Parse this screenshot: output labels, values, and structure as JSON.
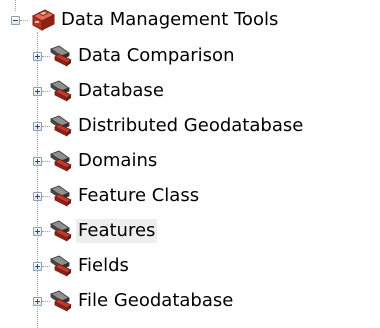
{
  "root": {
    "label": "Data Management Tools",
    "expanded": true,
    "icon": "red-toolbox-icon"
  },
  "items": [
    {
      "label": "Data Comparison",
      "expanded": false,
      "icon": "toolset-hammer-icon"
    },
    {
      "label": "Database",
      "expanded": false,
      "icon": "toolset-hammer-icon"
    },
    {
      "label": "Distributed Geodatabase",
      "expanded": false,
      "icon": "toolset-hammer-icon"
    },
    {
      "label": "Domains",
      "expanded": false,
      "icon": "toolset-hammer-icon"
    },
    {
      "label": "Feature Class",
      "expanded": false,
      "icon": "toolset-hammer-icon"
    },
    {
      "label": "Features",
      "expanded": false,
      "icon": "toolset-hammer-icon",
      "hovered": true
    },
    {
      "label": "Fields",
      "expanded": false,
      "icon": "toolset-hammer-icon"
    },
    {
      "label": "File Geodatabase",
      "expanded": false,
      "icon": "toolset-hammer-icon"
    }
  ],
  "colors": {
    "hover_background": "#eeeeee",
    "tree_lines": "#a0a0a0"
  }
}
